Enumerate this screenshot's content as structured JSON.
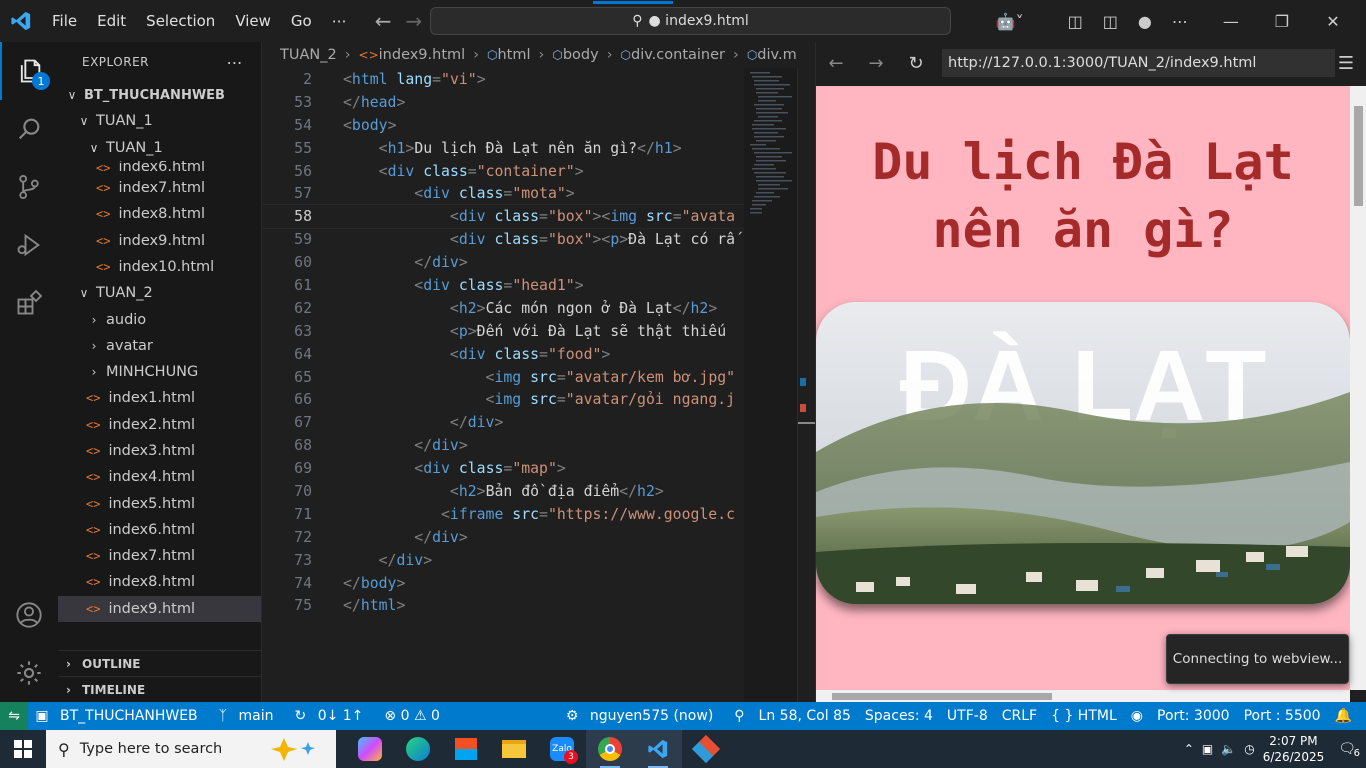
{
  "titlebar": {
    "menu": [
      "File",
      "Edit",
      "Selection",
      "View",
      "Go",
      "⋯"
    ],
    "command_center": "● index9.html"
  },
  "activity": {
    "explorer_badge": "1"
  },
  "sidebar": {
    "title": "EXPLORER",
    "more": "⋯",
    "tree": [
      {
        "label": "BT_THUCHANHWEB",
        "chev": "∨",
        "indent": 6,
        "bold": true
      },
      {
        "label": "TUAN_1",
        "chev": "∨",
        "indent": 18
      },
      {
        "label": "TUAN_1",
        "chev": "∨",
        "indent": 28
      },
      {
        "label": "index6.html",
        "icon": true,
        "indent": 38
      },
      {
        "label": "index7.html",
        "icon": true,
        "indent": 38
      },
      {
        "label": "index8.html",
        "icon": true,
        "indent": 38
      },
      {
        "label": "index9.html",
        "icon": true,
        "indent": 38
      },
      {
        "label": "index10.html",
        "icon": true,
        "indent": 38
      },
      {
        "label": "TUAN_2",
        "chev": "∨",
        "indent": 18
      },
      {
        "label": "audio",
        "chev": "›",
        "indent": 28
      },
      {
        "label": "avatar",
        "chev": "›",
        "indent": 28
      },
      {
        "label": "MINHCHUNG",
        "chev": "›",
        "indent": 28
      },
      {
        "label": "index1.html",
        "icon": true,
        "indent": 28
      },
      {
        "label": "index2.html",
        "icon": true,
        "indent": 28
      },
      {
        "label": "index3.html",
        "icon": true,
        "indent": 28
      },
      {
        "label": "index4.html",
        "icon": true,
        "indent": 28
      },
      {
        "label": "index5.html",
        "icon": true,
        "indent": 28
      },
      {
        "label": "index6.html",
        "icon": true,
        "indent": 28
      },
      {
        "label": "index7.html",
        "icon": true,
        "indent": 28
      },
      {
        "label": "index8.html",
        "icon": true,
        "indent": 28
      },
      {
        "label": "index9.html",
        "icon": true,
        "indent": 28,
        "selected": true
      }
    ],
    "outline": "OUTLINE",
    "timeline": "TIMELINE"
  },
  "breadcrumb": [
    "TUAN_2",
    "index9.html",
    "html",
    "body",
    "div.container",
    "div.m"
  ],
  "code": [
    {
      "n": "2",
      "parts": [
        [
          "t",
          "<"
        ],
        [
          "tg",
          "html"
        ],
        [
          "tx",
          " "
        ],
        [
          "at",
          "lang"
        ],
        [
          "t",
          "="
        ],
        [
          "av",
          "\"vi\""
        ],
        [
          "t",
          ">"
        ]
      ]
    },
    {
      "n": "53",
      "parts": [
        [
          "t",
          "</"
        ],
        [
          "tg",
          "head"
        ],
        [
          "t",
          ">"
        ]
      ]
    },
    {
      "n": "54",
      "parts": [
        [
          "t",
          "<"
        ],
        [
          "tg",
          "body"
        ],
        [
          "t",
          ">"
        ]
      ]
    },
    {
      "n": "55",
      "parts": [
        [
          "tx",
          "    "
        ],
        [
          "t",
          "<"
        ],
        [
          "tg",
          "h1"
        ],
        [
          "t",
          ">"
        ],
        [
          "tx",
          "Du lịch Đà Lạt nên ăn gì?"
        ],
        [
          "t",
          "</"
        ],
        [
          "tg",
          "h1"
        ],
        [
          "t",
          ">"
        ]
      ]
    },
    {
      "n": "56",
      "parts": [
        [
          "tx",
          "    "
        ],
        [
          "t",
          "<"
        ],
        [
          "tg",
          "div"
        ],
        [
          "tx",
          " "
        ],
        [
          "at",
          "class"
        ],
        [
          "t",
          "="
        ],
        [
          "av",
          "\"container\""
        ],
        [
          "t",
          ">"
        ]
      ]
    },
    {
      "n": "57",
      "parts": [
        [
          "tx",
          "        "
        ],
        [
          "t",
          "<"
        ],
        [
          "tg",
          "div"
        ],
        [
          "tx",
          " "
        ],
        [
          "at",
          "class"
        ],
        [
          "t",
          "="
        ],
        [
          "av",
          "\"mota\""
        ],
        [
          "t",
          ">"
        ]
      ]
    },
    {
      "n": "58",
      "cur": true,
      "parts": [
        [
          "tx",
          "            "
        ],
        [
          "t",
          "<"
        ],
        [
          "tg",
          "div"
        ],
        [
          "tx",
          " "
        ],
        [
          "at",
          "class"
        ],
        [
          "t",
          "="
        ],
        [
          "av",
          "\"box\""
        ],
        [
          "t",
          "><"
        ],
        [
          "tg",
          "img"
        ],
        [
          "tx",
          " "
        ],
        [
          "at",
          "src"
        ],
        [
          "t",
          "="
        ],
        [
          "av",
          "\"avata"
        ]
      ]
    },
    {
      "n": "59",
      "parts": [
        [
          "tx",
          "            "
        ],
        [
          "t",
          "<"
        ],
        [
          "tg",
          "div"
        ],
        [
          "tx",
          " "
        ],
        [
          "at",
          "class"
        ],
        [
          "t",
          "="
        ],
        [
          "av",
          "\"box\""
        ],
        [
          "t",
          "><"
        ],
        [
          "tg",
          "p"
        ],
        [
          "t",
          ">"
        ],
        [
          "tx",
          "Đà Lạt có rấ"
        ]
      ]
    },
    {
      "n": "60",
      "parts": [
        [
          "tx",
          "        "
        ],
        [
          "t",
          "</"
        ],
        [
          "tg",
          "div"
        ],
        [
          "t",
          ">"
        ]
      ]
    },
    {
      "n": "61",
      "parts": [
        [
          "tx",
          "        "
        ],
        [
          "t",
          "<"
        ],
        [
          "tg",
          "div"
        ],
        [
          "tx",
          " "
        ],
        [
          "at",
          "class"
        ],
        [
          "t",
          "="
        ],
        [
          "av",
          "\"head1\""
        ],
        [
          "t",
          ">"
        ]
      ]
    },
    {
      "n": "62",
      "parts": [
        [
          "tx",
          "            "
        ],
        [
          "t",
          "<"
        ],
        [
          "tg",
          "h2"
        ],
        [
          "t",
          ">"
        ],
        [
          "tx",
          "Các món ngon ở Đà Lạt"
        ],
        [
          "t",
          "</"
        ],
        [
          "tg",
          "h2"
        ],
        [
          "t",
          ">"
        ]
      ]
    },
    {
      "n": "63",
      "parts": [
        [
          "tx",
          "            "
        ],
        [
          "t",
          "<"
        ],
        [
          "tg",
          "p"
        ],
        [
          "t",
          ">"
        ],
        [
          "tx",
          "Đến với Đà Lạt sẽ thật thiếu"
        ]
      ]
    },
    {
      "n": "64",
      "parts": [
        [
          "tx",
          "            "
        ],
        [
          "t",
          "<"
        ],
        [
          "tg",
          "div"
        ],
        [
          "tx",
          " "
        ],
        [
          "at",
          "class"
        ],
        [
          "t",
          "="
        ],
        [
          "av",
          "\"food\""
        ],
        [
          "t",
          ">"
        ]
      ]
    },
    {
      "n": "65",
      "parts": [
        [
          "tx",
          "                "
        ],
        [
          "t",
          "<"
        ],
        [
          "tg",
          "img"
        ],
        [
          "tx",
          " "
        ],
        [
          "at",
          "src"
        ],
        [
          "t",
          "="
        ],
        [
          "av",
          "\"avatar/kem bơ.jpg\""
        ]
      ]
    },
    {
      "n": "66",
      "parts": [
        [
          "tx",
          "                "
        ],
        [
          "t",
          "<"
        ],
        [
          "tg",
          "img"
        ],
        [
          "tx",
          " "
        ],
        [
          "at",
          "src"
        ],
        [
          "t",
          "="
        ],
        [
          "av",
          "\"avatar/gỏi ngang.j"
        ]
      ]
    },
    {
      "n": "67",
      "parts": [
        [
          "tx",
          "            "
        ],
        [
          "t",
          "</"
        ],
        [
          "tg",
          "div"
        ],
        [
          "t",
          ">"
        ]
      ]
    },
    {
      "n": "68",
      "parts": [
        [
          "tx",
          "        "
        ],
        [
          "t",
          "</"
        ],
        [
          "tg",
          "div"
        ],
        [
          "t",
          ">"
        ]
      ]
    },
    {
      "n": "69",
      "parts": [
        [
          "tx",
          "        "
        ],
        [
          "t",
          "<"
        ],
        [
          "tg",
          "div"
        ],
        [
          "tx",
          " "
        ],
        [
          "at",
          "class"
        ],
        [
          "t",
          "="
        ],
        [
          "av",
          "\"map\""
        ],
        [
          "t",
          ">"
        ]
      ]
    },
    {
      "n": "70",
      "parts": [
        [
          "tx",
          "            "
        ],
        [
          "t",
          "<"
        ],
        [
          "tg",
          "h2"
        ],
        [
          "t",
          ">"
        ],
        [
          "tx",
          "Bản đồ địa điểm"
        ],
        [
          "t",
          "</"
        ],
        [
          "tg",
          "h2"
        ],
        [
          "t",
          ">"
        ]
      ]
    },
    {
      "n": "71",
      "parts": [
        [
          "tx",
          "           "
        ],
        [
          "t",
          "<"
        ],
        [
          "tg",
          "iframe"
        ],
        [
          "tx",
          " "
        ],
        [
          "at",
          "src"
        ],
        [
          "t",
          "="
        ],
        [
          "av",
          "\"https://www.google.c"
        ]
      ]
    },
    {
      "n": "72",
      "parts": [
        [
          "tx",
          "        "
        ],
        [
          "t",
          "</"
        ],
        [
          "tg",
          "div"
        ],
        [
          "t",
          ">"
        ]
      ]
    },
    {
      "n": "73",
      "parts": [
        [
          "tx",
          "    "
        ],
        [
          "t",
          "</"
        ],
        [
          "tg",
          "div"
        ],
        [
          "t",
          ">"
        ]
      ]
    },
    {
      "n": "74",
      "parts": [
        [
          "t",
          "</"
        ],
        [
          "tg",
          "body"
        ],
        [
          "t",
          ">"
        ]
      ]
    },
    {
      "n": "75",
      "parts": [
        [
          "t",
          "</"
        ],
        [
          "tg",
          "html"
        ],
        [
          "t",
          ">"
        ]
      ]
    }
  ],
  "preview": {
    "url": "http://127.0.0.1:3000/TUAN_2/index9.html",
    "title": "Du lịch Đà Lạt nên ăn gì?",
    "banner_text": "ĐÀ LẠT",
    "toast": "Connecting to webview...",
    "bg": "#ffb6c1",
    "title_color": "#a52a2a"
  },
  "statusbar": {
    "workspace": "BT_THUCHANHWEB",
    "branch": "main",
    "sync": "0↓ 1↑",
    "problems": "⊗ 0 ⚠ 0",
    "user": "nguyen575 (now)",
    "position": "Ln 58, Col 85",
    "spaces": "Spaces: 4",
    "encoding": "UTF-8",
    "eol": "CRLF",
    "language": "{ } HTML",
    "port": "Port: 3000",
    "port2": "Port : 5500",
    "color": "#007acc"
  },
  "taskbar": {
    "search_placeholder": "Type here to search",
    "zalo_badge": "3",
    "time": "2:07 PM",
    "date": "6/26/2025",
    "notif": "6"
  }
}
